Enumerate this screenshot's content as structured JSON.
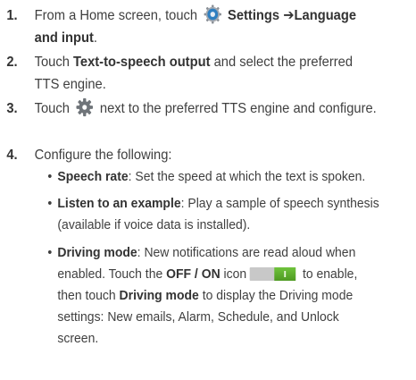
{
  "steps": [
    {
      "number": "1.",
      "text_1": "From a Home screen, touch",
      "settings_label": "Settings",
      "arrow": "➔",
      "path_label": "Language and input",
      "end": "."
    },
    {
      "number": "2.",
      "text_1": "Touch ",
      "tts_label": "Text-to-speech output",
      "text_2": " and select the preferred TTS engine."
    },
    {
      "number": "3.",
      "text_1": "Touch",
      "text_2": "next to the preferred TTS engine and configure."
    },
    {
      "number": "4.",
      "text_1": "Configure the following:"
    }
  ],
  "options": [
    {
      "bullet": "•",
      "label": "Speech rate",
      "text": ": Set the speed at which the text is spoken."
    },
    {
      "bullet": "•",
      "label": "Listen to an example",
      "text": ": Play a sample of speech synthesis (available if voice data is installed)."
    },
    {
      "bullet": "•",
      "label": "Driving mode",
      "text_1": ": New notifications are read aloud when enabled. Touch the ",
      "toggle_label": "OFF / ON",
      "text_2": " icon",
      "text_3": " to enable, then touch ",
      "label_2": "Driving mode",
      "text_4": " to display the Driving mode settings: New emails, Alarm, Schedule, and Unlock screen."
    }
  ],
  "icons": {
    "settings": "settings-app-icon",
    "gear": "gear-icon",
    "toggle": "toggle-on-icon"
  },
  "colors": {
    "text": "#3f3f3f",
    "toggle_on": "#5aae2a",
    "toggle_track": "#c8c8c8",
    "settings_icon": "#2f7fc0"
  }
}
